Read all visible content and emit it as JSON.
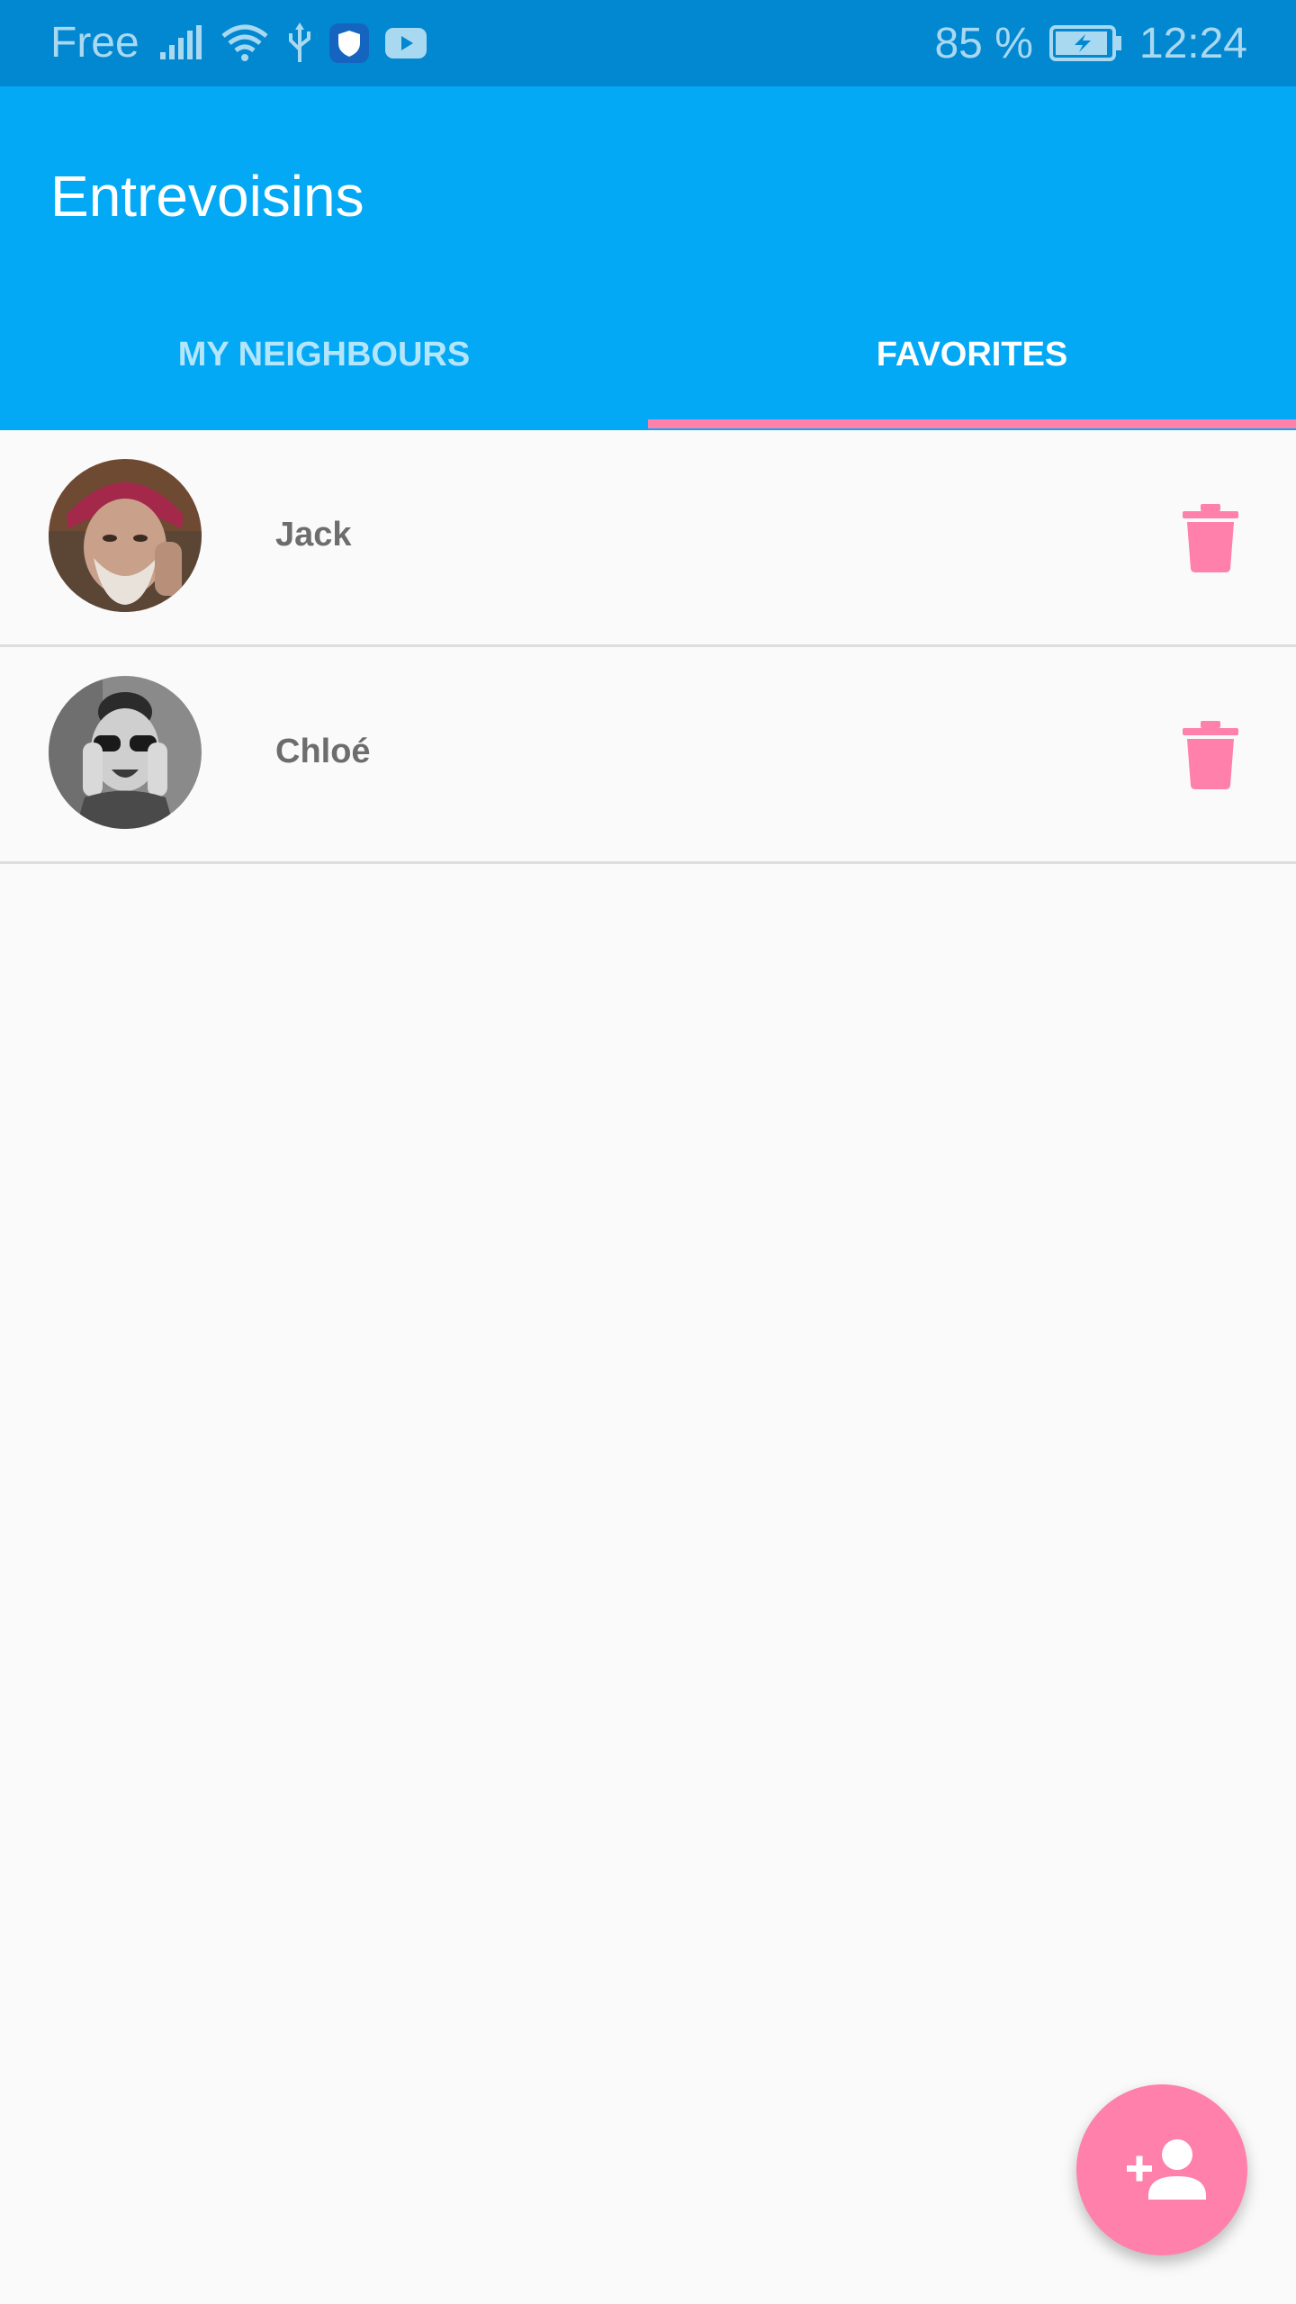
{
  "status_bar": {
    "carrier": "Free",
    "battery": "85 %",
    "time": "12:24",
    "icons": [
      "signal-icon",
      "wifi-icon",
      "usb-icon",
      "shield-icon",
      "youtube-icon",
      "battery-charging-icon"
    ]
  },
  "app_bar": {
    "title": "Entrevoisins",
    "tabs": [
      {
        "label": "MY NEIGHBOURS",
        "selected": false
      },
      {
        "label": "FAVORITES",
        "selected": true
      }
    ]
  },
  "favorites": [
    {
      "name": "Jack",
      "avatar": "avatar-photo"
    },
    {
      "name": "Chloé",
      "avatar": "avatar-photo"
    }
  ],
  "fab": {
    "icon": "person-add-icon"
  },
  "colors": {
    "status_bar": "#0288d1",
    "primary": "#03a9f4",
    "accent": "#ff80ab",
    "background": "#fafafa",
    "name_text": "#6d6d6d"
  }
}
